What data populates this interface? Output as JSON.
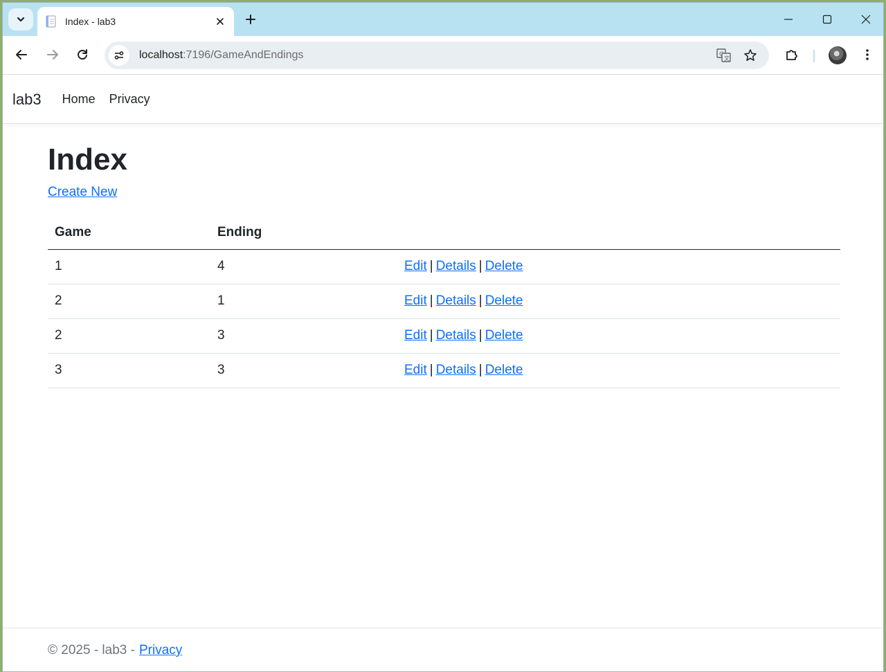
{
  "browser": {
    "tab": {
      "title": "Index - lab3"
    },
    "url": {
      "host": "localhost",
      "path": ":7196/GameAndEndings"
    },
    "icons": [
      "tab-search-icon",
      "favicon-icon",
      "close-icon",
      "plus-icon",
      "minimize-icon",
      "maximize-icon",
      "close-window-icon",
      "back-arrow-icon",
      "forward-arrow-icon",
      "reload-icon",
      "site-info-icon",
      "translate-icon",
      "star-icon",
      "extensions-icon",
      "profile-avatar",
      "more-vert-icon"
    ]
  },
  "navbar": {
    "brand": "lab3",
    "links": [
      "Home",
      "Privacy"
    ]
  },
  "main": {
    "title": "Index",
    "create_link": "Create New",
    "table": {
      "headers": [
        "Game",
        "Ending"
      ],
      "rows": [
        {
          "game": "1",
          "ending": "4"
        },
        {
          "game": "2",
          "ending": "1"
        },
        {
          "game": "2",
          "ending": "3"
        },
        {
          "game": "3",
          "ending": "3"
        }
      ],
      "actions": {
        "edit": "Edit",
        "details": "Details",
        "delete": "Delete",
        "separator": "|"
      }
    }
  },
  "footer": {
    "text": "© 2025 - lab3 -",
    "link": "Privacy"
  },
  "colors": {
    "link": "#0d6efd",
    "tabstrip": "#b8e2f2",
    "text": "#212529",
    "muted": "#6c757d"
  }
}
